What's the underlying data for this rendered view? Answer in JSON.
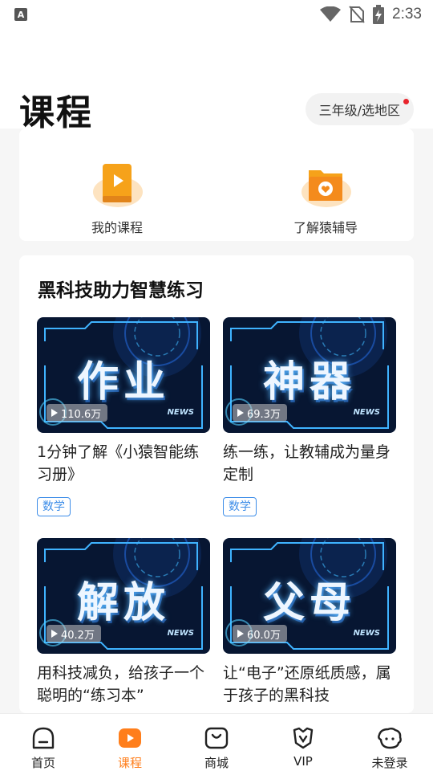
{
  "status_bar": {
    "time": "2:33",
    "app_icon_letter": "A"
  },
  "header": {
    "title": "课程",
    "grade_selector": "三年级/选地区"
  },
  "quick_links": [
    {
      "label": "我的课程",
      "icon": "book-play-icon"
    },
    {
      "label": "了解猿辅导",
      "icon": "folder-heart-icon"
    }
  ],
  "section": {
    "title": "黑科技助力智慧练习"
  },
  "videos": [
    {
      "thumb_word": "作业",
      "plays": "110.6万",
      "title": "1分钟了解《小猿智能练习册》",
      "subject": "数学",
      "badge": "NEWS"
    },
    {
      "thumb_word": "神器",
      "plays": "69.3万",
      "title": "练一练，让教辅成为量身定制",
      "subject": "数学",
      "badge": "NEWS"
    },
    {
      "thumb_word": "解放",
      "plays": "40.2万",
      "title": "用科技减负，给孩子一个聪明的“练习本”",
      "subject": "",
      "badge": "NEWS"
    },
    {
      "thumb_word": "父母",
      "plays": "60.0万",
      "title": "让“电子”还原纸质感，属于孩子的黑科技",
      "subject": "",
      "badge": "NEWS"
    }
  ],
  "bottom_nav": [
    {
      "label": "首页",
      "icon": "home-icon",
      "active": false
    },
    {
      "label": "课程",
      "icon": "course-play-icon",
      "active": true
    },
    {
      "label": "商城",
      "icon": "shop-bag-icon",
      "active": false
    },
    {
      "label": "VIP",
      "icon": "vip-icon",
      "active": false
    },
    {
      "label": "未登录",
      "icon": "avatar-icon",
      "active": false
    }
  ],
  "colors": {
    "accent": "#ff7e1b",
    "tag_blue": "#3d8de8",
    "badge_red": "#e8242c"
  }
}
